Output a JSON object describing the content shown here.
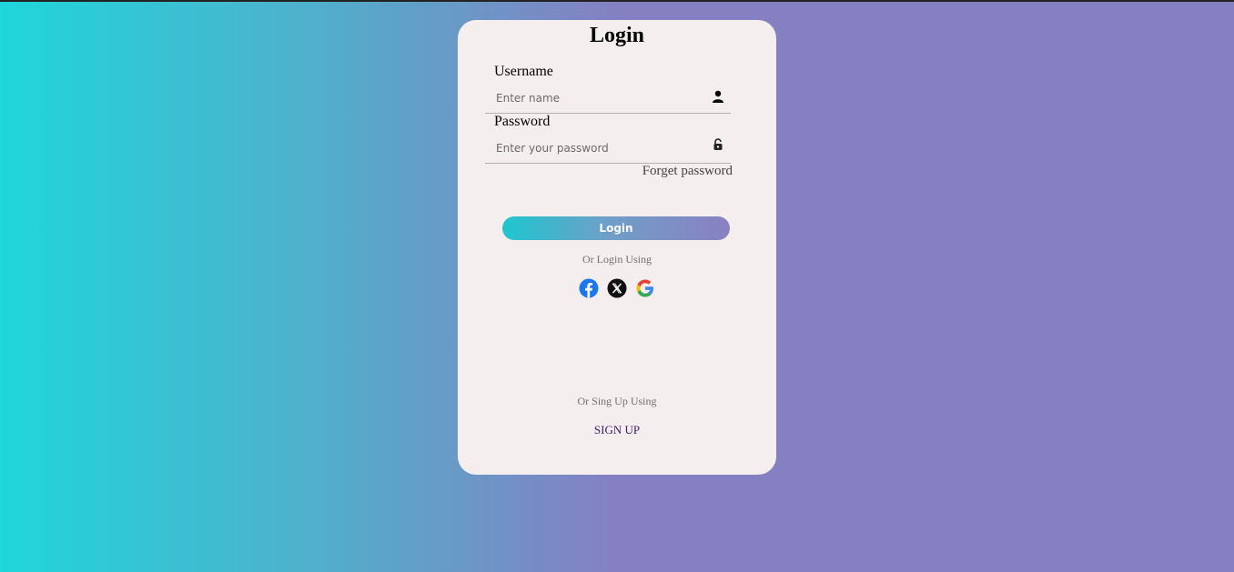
{
  "form": {
    "title": "Login",
    "username_label": "Username",
    "username_placeholder": "Enter name",
    "password_label": "Password",
    "password_placeholder": "Enter your password",
    "forget_password": "Forget password",
    "login_button": "Login",
    "or_login_using": "Or Login Using",
    "or_signup_using": "Or Sing Up Using",
    "signup_link": "SIGN UP"
  },
  "socials": [
    "facebook-icon",
    "x-icon",
    "google-icon"
  ],
  "colors": {
    "gradient_start": "#1fd6da",
    "gradient_end": "#8480c1",
    "card_bg": "#f5eeee",
    "facebook": "#1877f2",
    "signup": "#3a1a6a"
  }
}
